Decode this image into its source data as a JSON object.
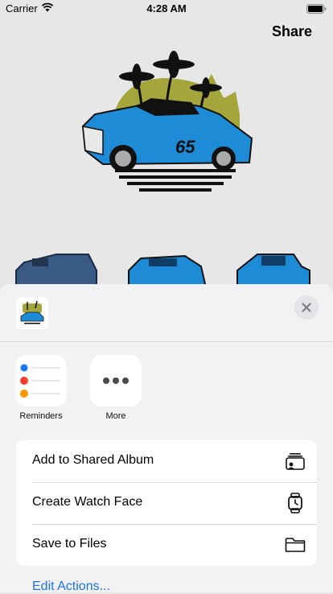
{
  "status_bar": {
    "carrier": "Carrier",
    "time": "4:28 AM"
  },
  "nav": {
    "share_label": "Share"
  },
  "share_sheet": {
    "apps": [
      {
        "label": "Reminders",
        "icon": "reminders-icon"
      },
      {
        "label": "More",
        "icon": "more-icon"
      }
    ],
    "actions": [
      {
        "label": "Add to Shared Album",
        "icon": "shared-album-icon"
      },
      {
        "label": "Create Watch Face",
        "icon": "watch-icon"
      },
      {
        "label": "Save to Files",
        "icon": "folder-icon"
      }
    ],
    "edit_actions": "Edit Actions..."
  },
  "colors": {
    "accent": "#1a73e8",
    "reminders_dots": [
      "#1877f2",
      "#ff3b30",
      "#ff9500"
    ]
  }
}
